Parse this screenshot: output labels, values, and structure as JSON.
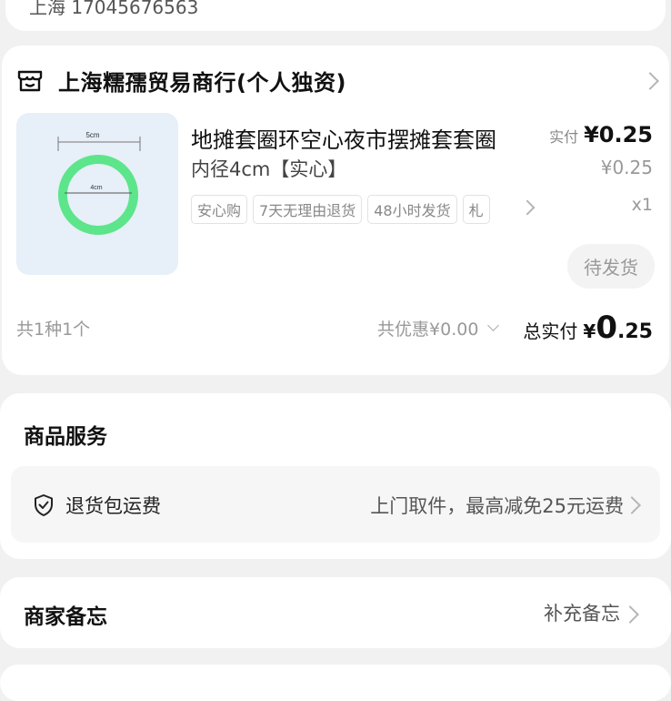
{
  "top_card": {
    "text": "上海 17045676563"
  },
  "shop": {
    "name": "上海糯孺贸易商行(个人独资)",
    "icon": "store-icon"
  },
  "product": {
    "title_line1": "地摊套圈环空心夜市摆摊套套圈",
    "title_line2": "内径4cm【实心】",
    "image_labels": {
      "outer": "5cm",
      "inner": "4cm"
    },
    "ring_color": "#5ce58a",
    "tags": [
      "安心购",
      "7天无理由退货",
      "48小时发货",
      "札"
    ],
    "price_label": "实付",
    "price_real": "¥0.25",
    "price_original": "¥0.25",
    "quantity": "x1",
    "status_button": "待发货"
  },
  "summary": {
    "count": "共1种1个",
    "discount": "共优惠¥0.00",
    "total_label": "总实付",
    "total_currency": "¥",
    "total_int": "0",
    "total_dec": ".25"
  },
  "services": {
    "title": "商品服务",
    "item_label": "退货包运费",
    "item_desc": "上门取件，最高减免25元运费",
    "icon": "shield-check-icon"
  },
  "memo": {
    "title": "商家备忘",
    "action": "补充备忘"
  }
}
